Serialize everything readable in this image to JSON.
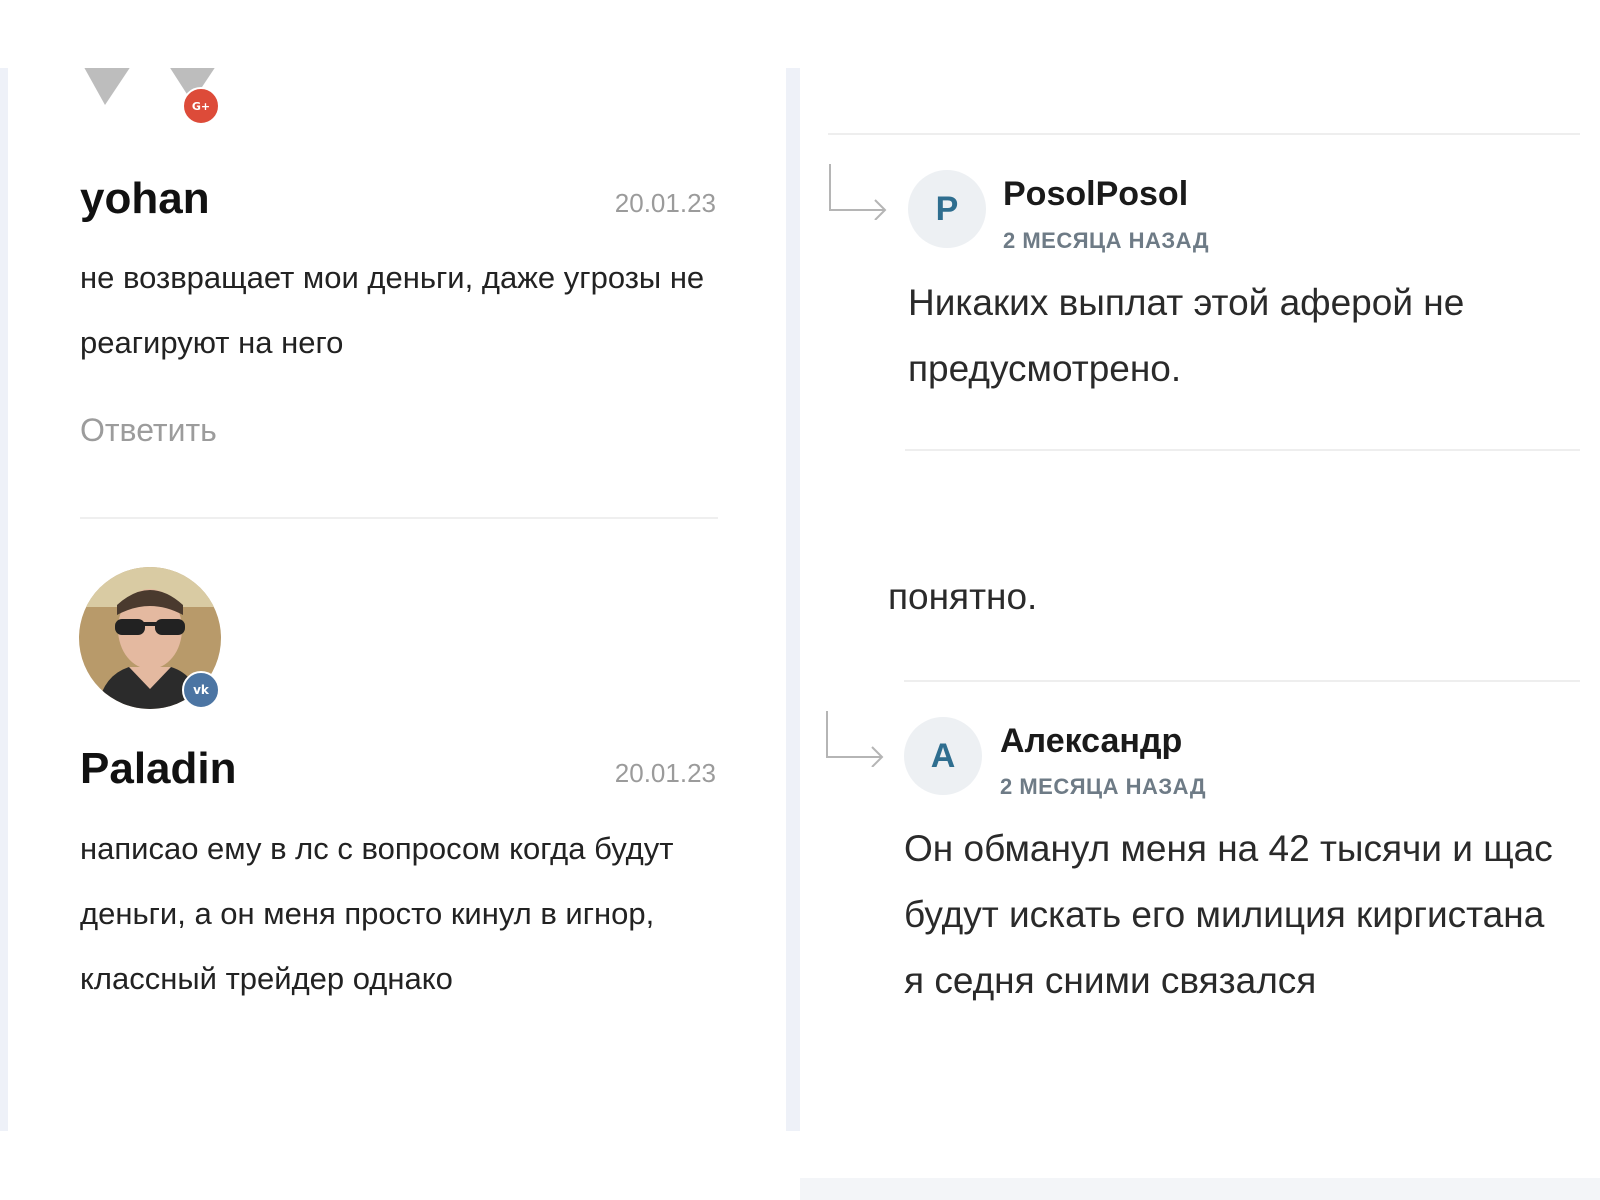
{
  "left_column": {
    "comments": [
      {
        "author": "yohan",
        "date": "20.01.23",
        "text": "не возвращает мои деньги, даже угрозы не реагируют на него",
        "reply_label": "Ответить",
        "social_badge": "G+",
        "social_icon": "google-plus-icon"
      },
      {
        "author": "Paladin",
        "date": "20.01.23",
        "text": "написао ему в лс с вопросом когда будут деньги, а он меня просто кинул в игнор, классный трейдер однако",
        "social_badge": "vk",
        "social_icon": "vk-icon"
      }
    ]
  },
  "right_column": {
    "replies": [
      {
        "avatar_letter": "P",
        "author": "PosolPosol",
        "time": "2 МЕСЯЦА НАЗАД",
        "text": "Никаких выплат этой аферой не предусмотрено."
      },
      {
        "avatar_letter": "A",
        "author": "Александр",
        "time": "2 МЕСЯЦА НАЗАД",
        "text": "Он обманул меня на 42 тысячи и щас будут искать его милиция киргистана я седня сними связался"
      }
    ],
    "cut_off_text": "понятно."
  },
  "colors": {
    "accent_avatar_text": "#2f6e8f",
    "google_plus": "#dd4b39",
    "vk": "#4c75a3",
    "muted_text": "#9c9c9c"
  }
}
